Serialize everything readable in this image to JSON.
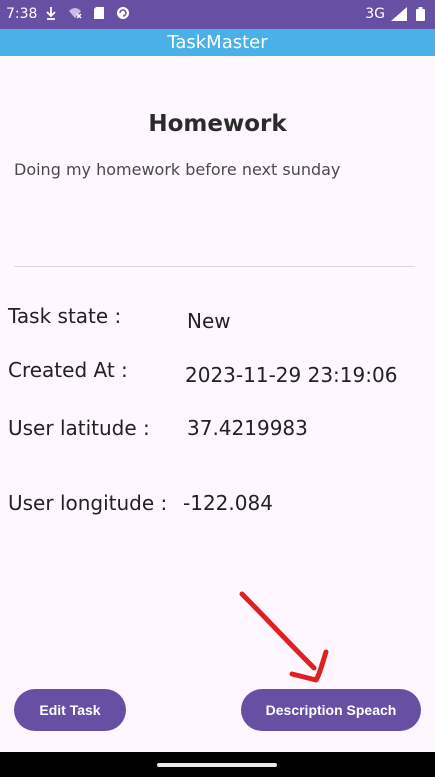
{
  "status_bar": {
    "time": "7:38",
    "network": "3G",
    "icons": [
      "download-icon",
      "wifi-off-icon",
      "sd-card-icon",
      "sync-icon",
      "signal-icon",
      "battery-icon"
    ]
  },
  "app_bar": {
    "title": "TaskMaster"
  },
  "task": {
    "title": "Homework",
    "description": "Doing my homework before next sunday",
    "details": {
      "state_label": "Task state :",
      "state_value": "New",
      "created_label": "Created At :",
      "created_value": "2023-11-29 23:19:06",
      "latitude_label": "User latitude :",
      "latitude_value": "37.4219983",
      "longitude_label": "User longitude :",
      "longitude_value": "-122.084"
    }
  },
  "actions": {
    "edit_label": "Edit Task",
    "speech_label": "Description Speach"
  },
  "colors": {
    "status_bar": "#6750a4",
    "app_bar": "#4ab1e8",
    "button": "#6750a4",
    "background": "#fef7ff",
    "annotation_arrow": "#e02020"
  },
  "annotation": {
    "type": "arrow-icon",
    "points_to": "description-speach-button"
  }
}
